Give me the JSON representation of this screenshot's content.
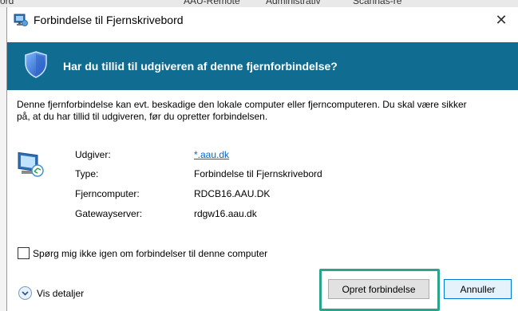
{
  "background_window": {
    "tabs": [
      "ord",
      "AAU-Remote",
      "Administrativ",
      "Scannas-re"
    ]
  },
  "dialog": {
    "title": "Forbindelse til Fjernskrivebord",
    "close_symbol": "✕",
    "banner_text": "Har du tillid til udgiveren af denne fjernforbindelse?",
    "banner_color": "#116c91",
    "warning_line1": "Denne fjernforbindelse kan evt. beskadige den lokale computer eller fjerncomputeren. Du skal være sikker",
    "warning_line2": "på, at du har tillid til udgiveren, før du opretter forbindelsen.",
    "info": {
      "publisher_label": "Udgiver:",
      "publisher_value": "*.aau.dk",
      "type_label": "Type:",
      "type_value": "Forbindelse til Fjernskrivebord",
      "remote_computer_label": "Fjerncomputer:",
      "remote_computer_value": "RDCB16.AAU.DK",
      "gateway_label": "Gatewayserver:",
      "gateway_value": "rdgw16.aau.dk"
    },
    "checkbox_label": "Spørg mig ikke igen om forbindelser til denne computer",
    "checkbox_checked": false,
    "details_label": "Vis detaljer",
    "connect_button": "Opret forbindelse",
    "cancel_button": "Annuller",
    "highlight_color": "#2aa58b"
  }
}
